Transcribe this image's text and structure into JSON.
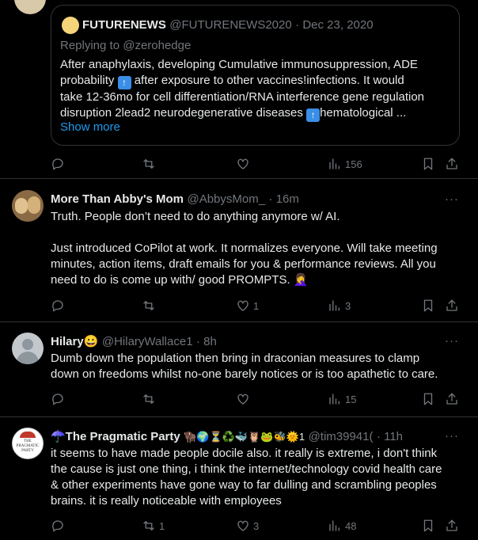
{
  "quoted": {
    "name": "FUTURENEWS",
    "handle": "@FUTURENEWS2020",
    "date": "· Dec 23, 2020",
    "replying": "Replying to @zerohedge",
    "line1": "After anaphylaxis, developing Cumulative immunosuppression, ADE",
    "line2a": "probability",
    "line2b": "after exposure to other vaccines!infections.  It would",
    "line3": "take 12-36mo for cell differentiation/RNA interference gene regulation",
    "line4a": "disruption 2lead2 neurodegenerative diseases",
    "line4b": "hematological  ...",
    "show_more": "Show more",
    "views": "156"
  },
  "tweets": [
    {
      "name": "More Than Abby's Mom",
      "handle": "@AbbysMom_",
      "time": "· 16m",
      "line1": "Truth. People don’t need to do anything anymore w/ AI.",
      "line2": "Just introduced CoPilot at work. It normalizes everyone. Will take meeting",
      "line3": "minutes, action items, draft emails for you & performance reviews. All you",
      "line4": "need to do is come up with/ good PROMPTS. 🤦‍♀️",
      "likes": "1",
      "views": "3"
    },
    {
      "name": "Hilary",
      "handle": "@HilaryWallace1",
      "time": "· 8h",
      "line1": "Dumb down the population then bring in draconian measures to clamp",
      "line2": "down on freedoms whilst no-one barely notices or is too apathetic to care.",
      "views": "15"
    },
    {
      "name": "☂️The Pragmatic Party",
      "emojis": "🦬🌍⏳♻️🐳🦉🐸🐝🌞1",
      "handle": "@tim39941(",
      "time": "· 11h",
      "line1": "it seems to have made people docile also. it really is extreme, i don't think",
      "line2": "the cause is just one thing, i think the internet/technology covid health care",
      "line3": "& other experiments have gone way to far dulling and scrambling peoples",
      "line4": "brains. it is really noticeable with employees",
      "retweets": "1",
      "likes": "3",
      "views": "48",
      "avatar_text": "THE PRAGMATIC PARTY"
    }
  ],
  "more_label": "···"
}
